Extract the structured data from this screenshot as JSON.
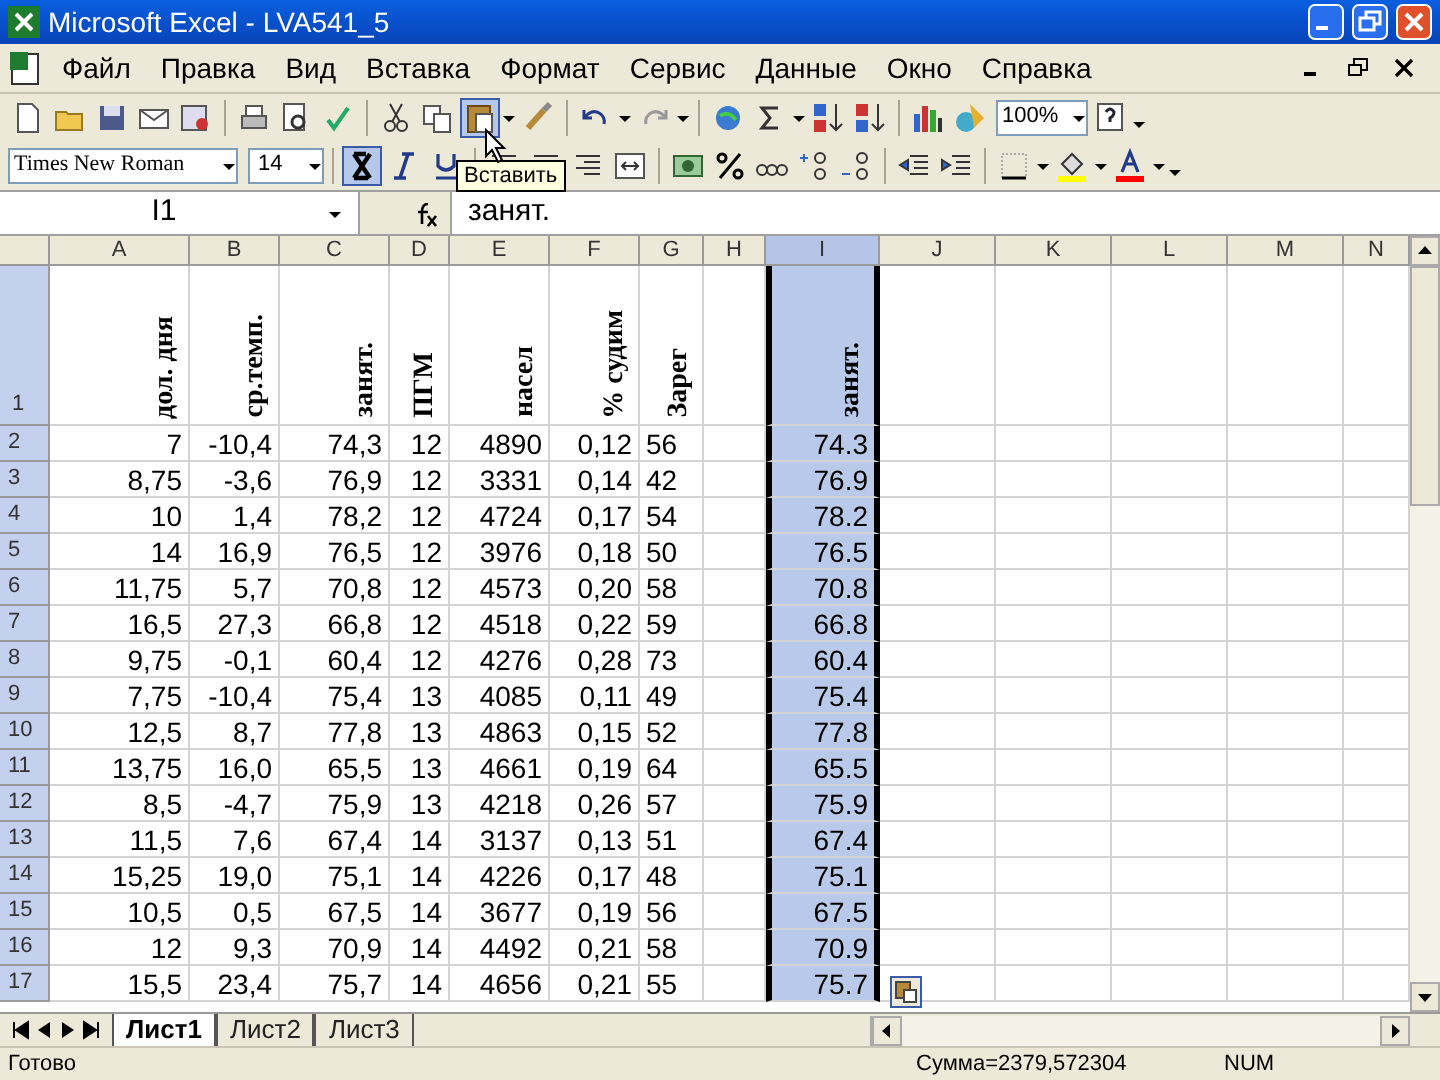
{
  "window": {
    "title": "Microsoft Excel - LVA541_5"
  },
  "menu": [
    "Файл",
    "Правка",
    "Вид",
    "Вставка",
    "Формат",
    "Сервис",
    "Данные",
    "Окно",
    "Справка"
  ],
  "toolbar": {
    "font": "Times New Roman",
    "font_size": "14",
    "zoom": "100%",
    "bold": true,
    "paste_hover": true
  },
  "tooltip": "Вставить",
  "formula_bar": {
    "cell": "I1",
    "content": "занят."
  },
  "columns": [
    {
      "label": "A",
      "selected": false
    },
    {
      "label": "B",
      "selected": false
    },
    {
      "label": "C",
      "selected": false
    },
    {
      "label": "D",
      "selected": false
    },
    {
      "label": "E",
      "selected": false
    },
    {
      "label": "F",
      "selected": false
    },
    {
      "label": "G",
      "selected": false
    },
    {
      "label": "H",
      "selected": false
    },
    {
      "label": "I",
      "selected": true
    },
    {
      "label": "J",
      "selected": false
    },
    {
      "label": "K",
      "selected": false
    },
    {
      "label": "L",
      "selected": false
    },
    {
      "label": "M",
      "selected": false
    },
    {
      "label": "N",
      "selected": false
    }
  ],
  "header_row": {
    "number": "1",
    "cells": [
      "дол. дня",
      "ср.темп.",
      "занят.",
      "ПГМ",
      "насел",
      "% судим",
      "Зарег"
    ],
    "i": "занят."
  },
  "rows": [
    {
      "number": "2",
      "cells": [
        "7",
        "-10,4",
        "74,3",
        "12",
        "4890",
        "0,12",
        "56"
      ],
      "i": "74.3"
    },
    {
      "number": "3",
      "cells": [
        "8,75",
        "-3,6",
        "76,9",
        "12",
        "3331",
        "0,14",
        "42"
      ],
      "i": "76.9"
    },
    {
      "number": "4",
      "cells": [
        "10",
        "1,4",
        "78,2",
        "12",
        "4724",
        "0,17",
        "54"
      ],
      "i": "78.2"
    },
    {
      "number": "5",
      "cells": [
        "14",
        "16,9",
        "76,5",
        "12",
        "3976",
        "0,18",
        "50"
      ],
      "i": "76.5"
    },
    {
      "number": "6",
      "cells": [
        "11,75",
        "5,7",
        "70,8",
        "12",
        "4573",
        "0,20",
        "58"
      ],
      "i": "70.8"
    },
    {
      "number": "7",
      "cells": [
        "16,5",
        "27,3",
        "66,8",
        "12",
        "4518",
        "0,22",
        "59"
      ],
      "i": "66.8"
    },
    {
      "number": "8",
      "cells": [
        "9,75",
        "-0,1",
        "60,4",
        "12",
        "4276",
        "0,28",
        "73"
      ],
      "i": "60.4"
    },
    {
      "number": "9",
      "cells": [
        "7,75",
        "-10,4",
        "75,4",
        "13",
        "4085",
        "0,11",
        "49"
      ],
      "i": "75.4"
    },
    {
      "number": "10",
      "cells": [
        "12,5",
        "8,7",
        "77,8",
        "13",
        "4863",
        "0,15",
        "52"
      ],
      "i": "77.8"
    },
    {
      "number": "11",
      "cells": [
        "13,75",
        "16,0",
        "65,5",
        "13",
        "4661",
        "0,19",
        "64"
      ],
      "i": "65.5"
    },
    {
      "number": "12",
      "cells": [
        "8,5",
        "-4,7",
        "75,9",
        "13",
        "4218",
        "0,26",
        "57"
      ],
      "i": "75.9"
    },
    {
      "number": "13",
      "cells": [
        "11,5",
        "7,6",
        "67,4",
        "14",
        "3137",
        "0,13",
        "51"
      ],
      "i": "67.4"
    },
    {
      "number": "14",
      "cells": [
        "15,25",
        "19,0",
        "75,1",
        "14",
        "4226",
        "0,17",
        "48"
      ],
      "i": "75.1"
    },
    {
      "number": "15",
      "cells": [
        "10,5",
        "0,5",
        "67,5",
        "14",
        "3677",
        "0,19",
        "56"
      ],
      "i": "67.5"
    },
    {
      "number": "16",
      "cells": [
        "12",
        "9,3",
        "70,9",
        "14",
        "4492",
        "0,21",
        "58"
      ],
      "i": "70.9"
    },
    {
      "number": "17",
      "cells": [
        "15,5",
        "23,4",
        "75,7",
        "14",
        "4656",
        "0,21",
        "55"
      ],
      "i": "75.7"
    }
  ],
  "sheets": [
    {
      "label": "Лист1",
      "selected": true
    },
    {
      "label": "Лист2",
      "selected": false
    },
    {
      "label": "Лист3",
      "selected": false
    }
  ],
  "status_bar": {
    "state": "Готово",
    "sum": "Сумма=2379,572304",
    "num": "NUM"
  }
}
